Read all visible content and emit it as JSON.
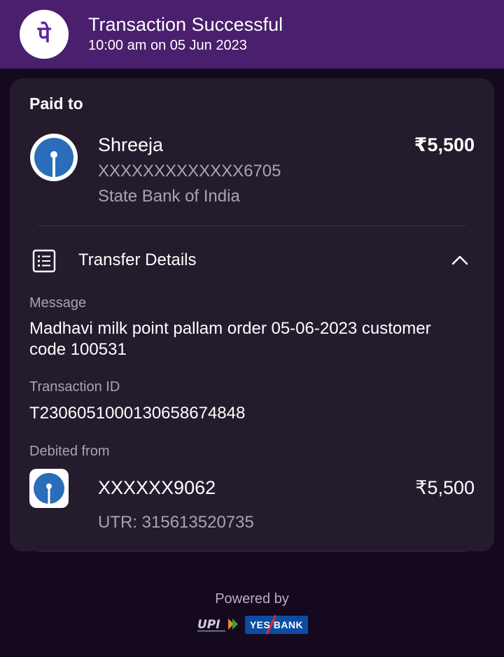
{
  "header": {
    "title": "Transaction Successful",
    "datetime": "10:00 am on 05 Jun 2023",
    "logo_icon": "phonepe-logo-icon",
    "logo_glyph": "पे",
    "bg_color": "#4a1f6e"
  },
  "paid_to": {
    "label": "Paid to",
    "name": "Shreeja",
    "amount": "₹5,500",
    "account": "XXXXXXXXXXXXX6705",
    "bank": "State Bank of India",
    "bank_icon": "sbi-logo-icon"
  },
  "transfer_details": {
    "label": "Transfer Details",
    "icon": "receipt-list-icon",
    "toggle_icon": "chevron-up-icon",
    "message_label": "Message",
    "message": "Madhavi milk point pallam order 05-06-2023 customer code 100531",
    "transaction_id_label": "Transaction ID",
    "transaction_id": "T2306051000130658674848",
    "debited_from_label": "Debited from",
    "debit_account": "XXXXXX9062",
    "debit_amount": "₹5,500",
    "utr": "UTR: 315613520735",
    "debit_bank_icon": "sbi-logo-icon"
  },
  "footer": {
    "powered_by": "Powered by",
    "upi_logo": "upi-logo-icon",
    "partner_bank": "YES BANK"
  },
  "colors": {
    "background": "#14091f",
    "card": "#241c2d",
    "muted_text": "#a9a3b0",
    "sbi_blue": "#2a6ebb"
  }
}
